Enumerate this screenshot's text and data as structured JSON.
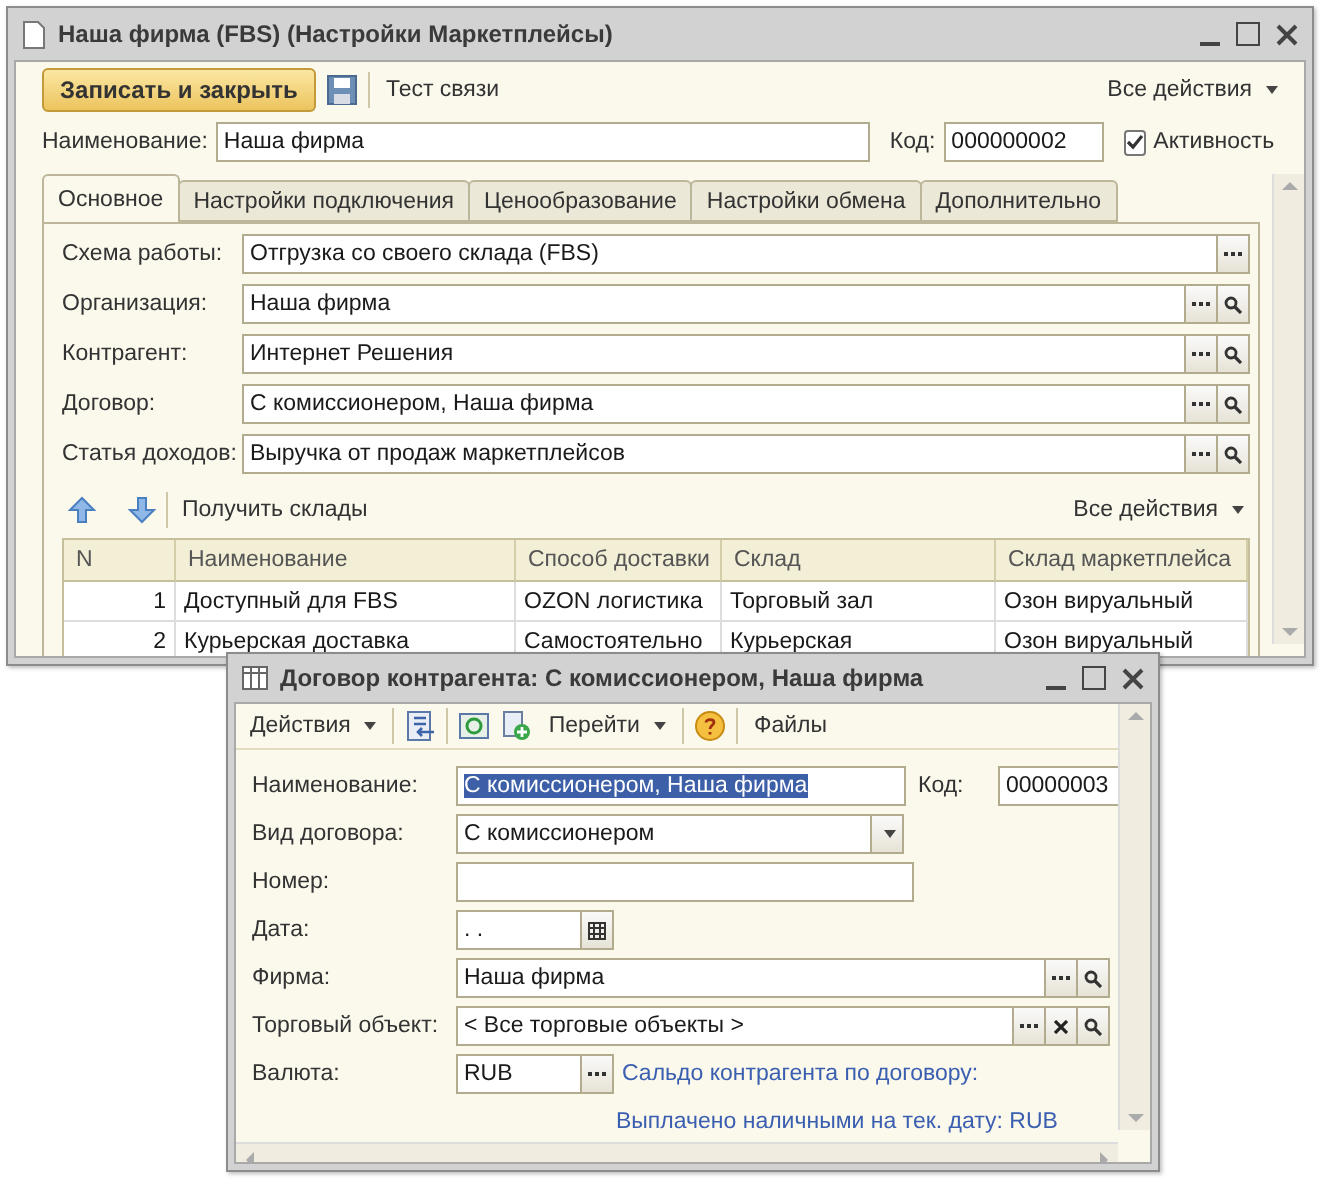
{
  "main_window": {
    "title": "Наша фирма (FBS) (Настройки Маркетплейсы)",
    "toolbar": {
      "save_close": "Записать и закрыть",
      "test": "Тест связи",
      "all_actions": "Все действия"
    },
    "name": {
      "label": "Наименование:",
      "value": "Наша фирма"
    },
    "code": {
      "label": "Код:",
      "value": "000000002"
    },
    "active": {
      "label": "Активность",
      "checked": true
    },
    "tabs": [
      {
        "label": "Основное",
        "selected": true
      },
      {
        "label": "Настройки подключения",
        "selected": false
      },
      {
        "label": "Ценообразование",
        "selected": false
      },
      {
        "label": "Настройки обмена",
        "selected": false
      },
      {
        "label": "Дополнительно",
        "selected": false
      }
    ],
    "fields": [
      {
        "label": "Схема работы:",
        "value": "Отгрузка со своего склада (FBS)",
        "kind": "select"
      },
      {
        "label": "Организация:",
        "value": "Наша фирма",
        "kind": "lookup"
      },
      {
        "label": "Контрагент:",
        "value": "Интернет Решения",
        "kind": "lookup"
      },
      {
        "label": "Договор:",
        "value": "С комиссионером, Наша фирма",
        "kind": "lookup"
      },
      {
        "label": "Статья доходов:",
        "value": "Выручка от продаж маркетплейсов",
        "kind": "lookup"
      }
    ],
    "table_toolbar": {
      "get_warehouses": "Получить склады",
      "all_actions": "Все действия"
    },
    "table": {
      "columns": [
        "N",
        "Наименование",
        "Способ доставки",
        "Склад",
        "Склад маркетплейса"
      ],
      "rows": [
        [
          "1",
          "Доступный для FBS",
          "OZON логистика",
          "Торговый зал",
          "Озон вируальный"
        ],
        [
          "2",
          "Курьерская доставка",
          "Самостоятельно",
          "Курьерская",
          "Озон вируальный"
        ]
      ]
    }
  },
  "contract_window": {
    "title": "Договор контрагента: С комиссионером, Наша фирма",
    "toolbar": {
      "actions": "Действия",
      "goto": "Перейти",
      "files": "Файлы"
    },
    "fields": [
      {
        "label": "Наименование:",
        "value": "С комиссионером, Наша фирма",
        "kind": "text",
        "highlighted": true,
        "extra_label": "Код:",
        "extra_value": "00000003"
      },
      {
        "label": "Вид договора:",
        "value": "С комиссионером",
        "kind": "dropdown"
      },
      {
        "label": "Номер:",
        "kind": "text"
      },
      {
        "label": "Дата:",
        "value": ". .",
        "kind": "date"
      },
      {
        "label": "Фирма:",
        "value": "Наша фирма",
        "kind": "lookup"
      },
      {
        "label": "Торговый объект:",
        "value": "< Все торговые объекты >",
        "kind": "lookup_clear"
      },
      {
        "label": "Валюта:",
        "value": "RUB",
        "kind": "currency",
        "link": "Сальдо контрагента по договору:"
      }
    ],
    "footer_link": "Выплачено наличными на тек. дату:  RUB"
  }
}
